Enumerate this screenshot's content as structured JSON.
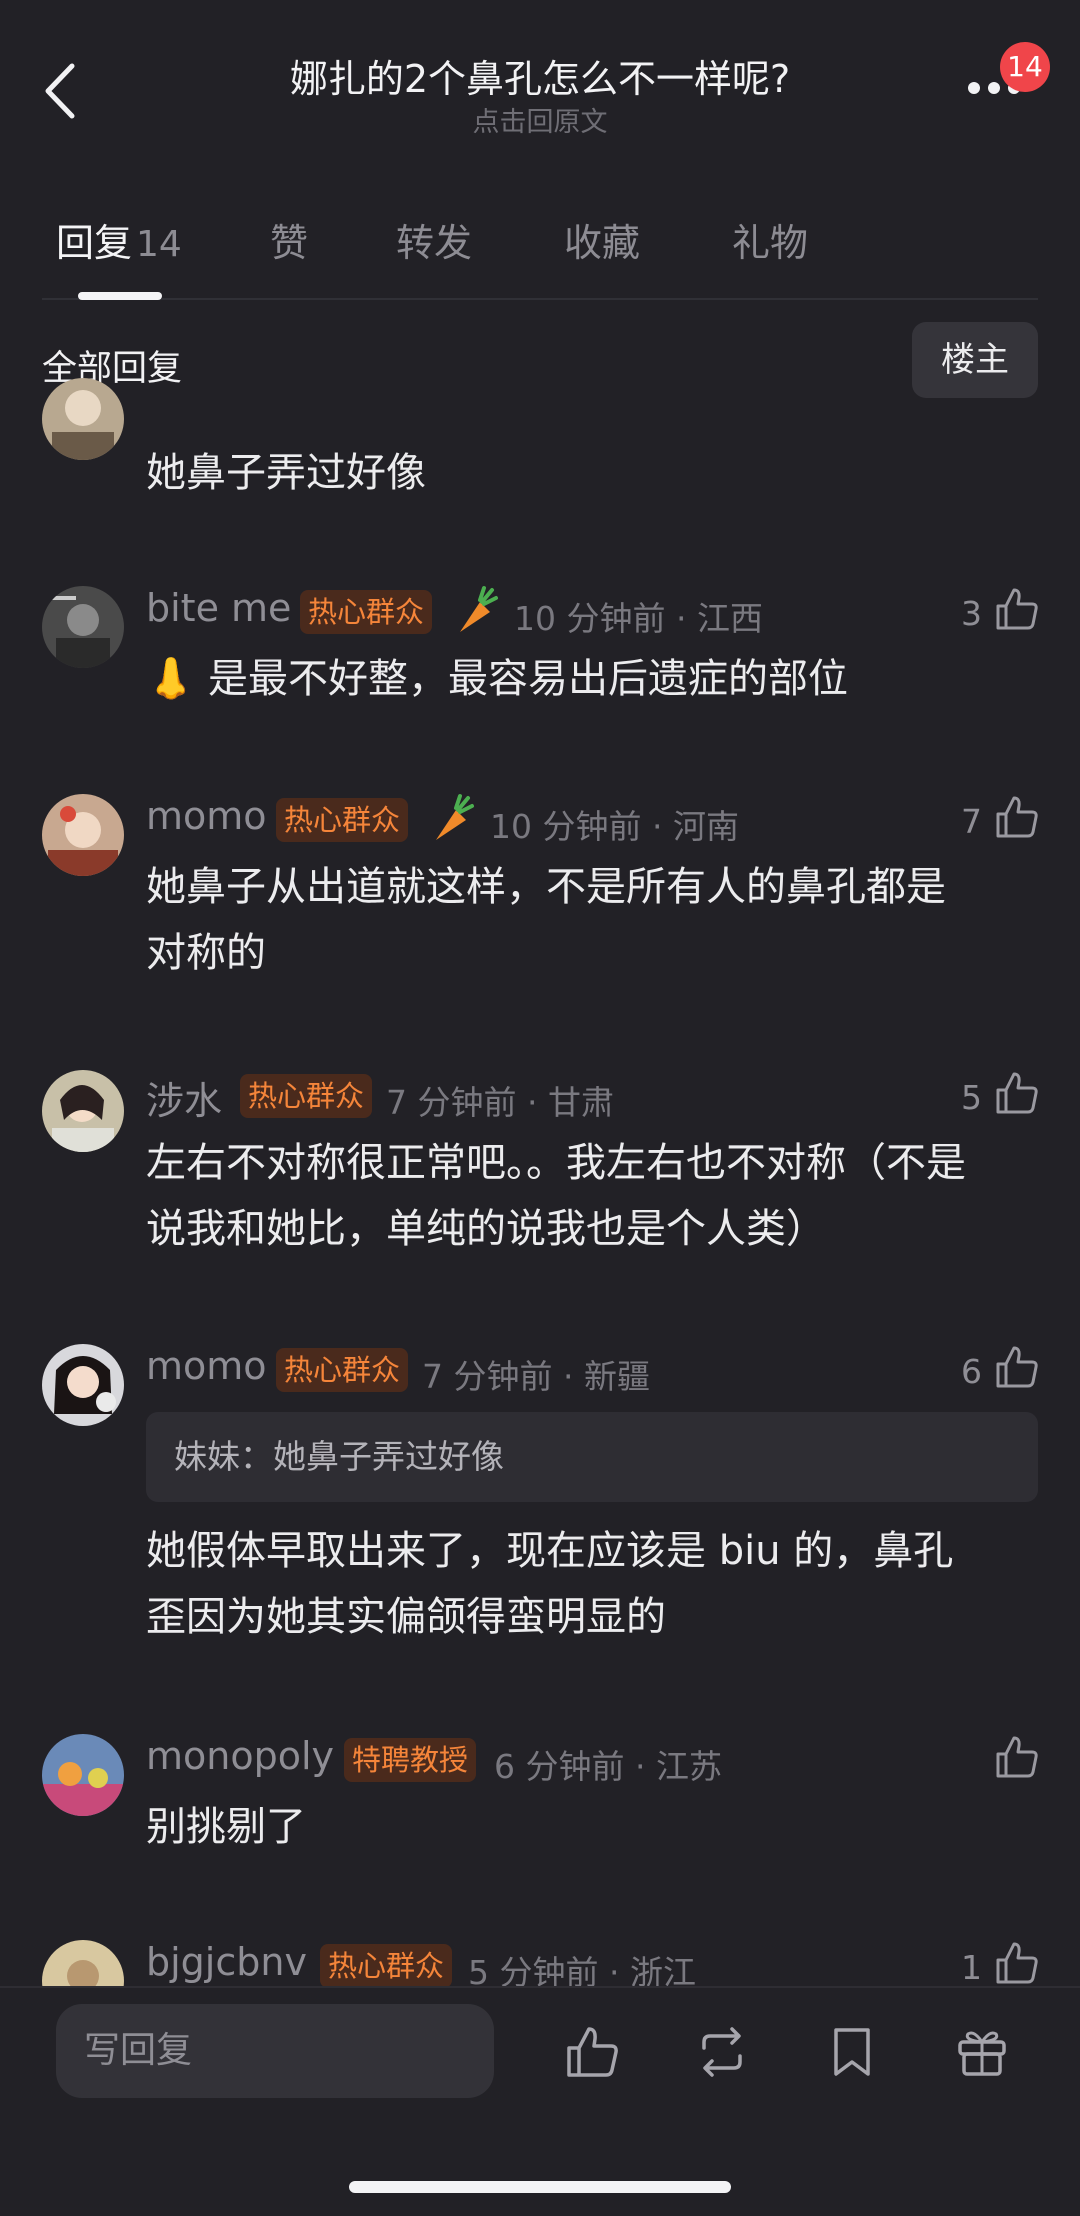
{
  "header": {
    "title": "娜扎的2个鼻孔怎么不一样呢?",
    "subtitle": "点击回原文",
    "notification_count": "14"
  },
  "tabs": [
    {
      "label": "回复",
      "count": "14"
    },
    {
      "label": "赞"
    },
    {
      "label": "转发"
    },
    {
      "label": "收藏"
    },
    {
      "label": "礼物"
    }
  ],
  "section": {
    "title": "全部回复",
    "filter": "楼主"
  },
  "comments": [
    {
      "content": "她鼻子弄过好像"
    },
    {
      "user": "bite me",
      "badge": "热心群众",
      "time": "10 分钟前 · 江西",
      "likes": "3",
      "content": "是最不好整，最容易出后遗症的部位",
      "emoji": "👃"
    },
    {
      "user": "momo",
      "badge": "热心群众",
      "time": "10 分钟前 · 河南",
      "likes": "7",
      "content_lines": [
        "她鼻子从出道就这样，不是所有人的鼻孔都是",
        "对称的"
      ]
    },
    {
      "user": "涉水",
      "badge": "热心群众",
      "time": "7 分钟前 · 甘肃",
      "likes": "5",
      "content_lines": [
        "左右不对称很正常吧。。我左右也不对称（不是",
        "说我和她比，单纯的说我也是个人类）"
      ]
    },
    {
      "user": "momo",
      "badge": "热心群众",
      "time": "7 分钟前 · 新疆",
      "likes": "6",
      "quote": "妹妹：她鼻子弄过好像",
      "content_lines": [
        "她假体早取出来了，现在应该是 biu 的，鼻孔",
        "歪因为她其实偏颌得蛮明显的"
      ]
    },
    {
      "user": "monopoly",
      "badge": "特聘教授",
      "time": "6 分钟前 · 江苏",
      "likes": "",
      "content": "别挑剔了"
    },
    {
      "user": "bjgjcbnv",
      "badge": "热心群众",
      "time": "5 分钟前 · 浙江",
      "likes": "1"
    }
  ],
  "bottom_bar": {
    "reply_placeholder": "写回复"
  },
  "colors": {
    "background": "#222126",
    "badge_text": "#f5853a",
    "badge_bg": "#4a2a1c",
    "notification": "#f0454a"
  }
}
